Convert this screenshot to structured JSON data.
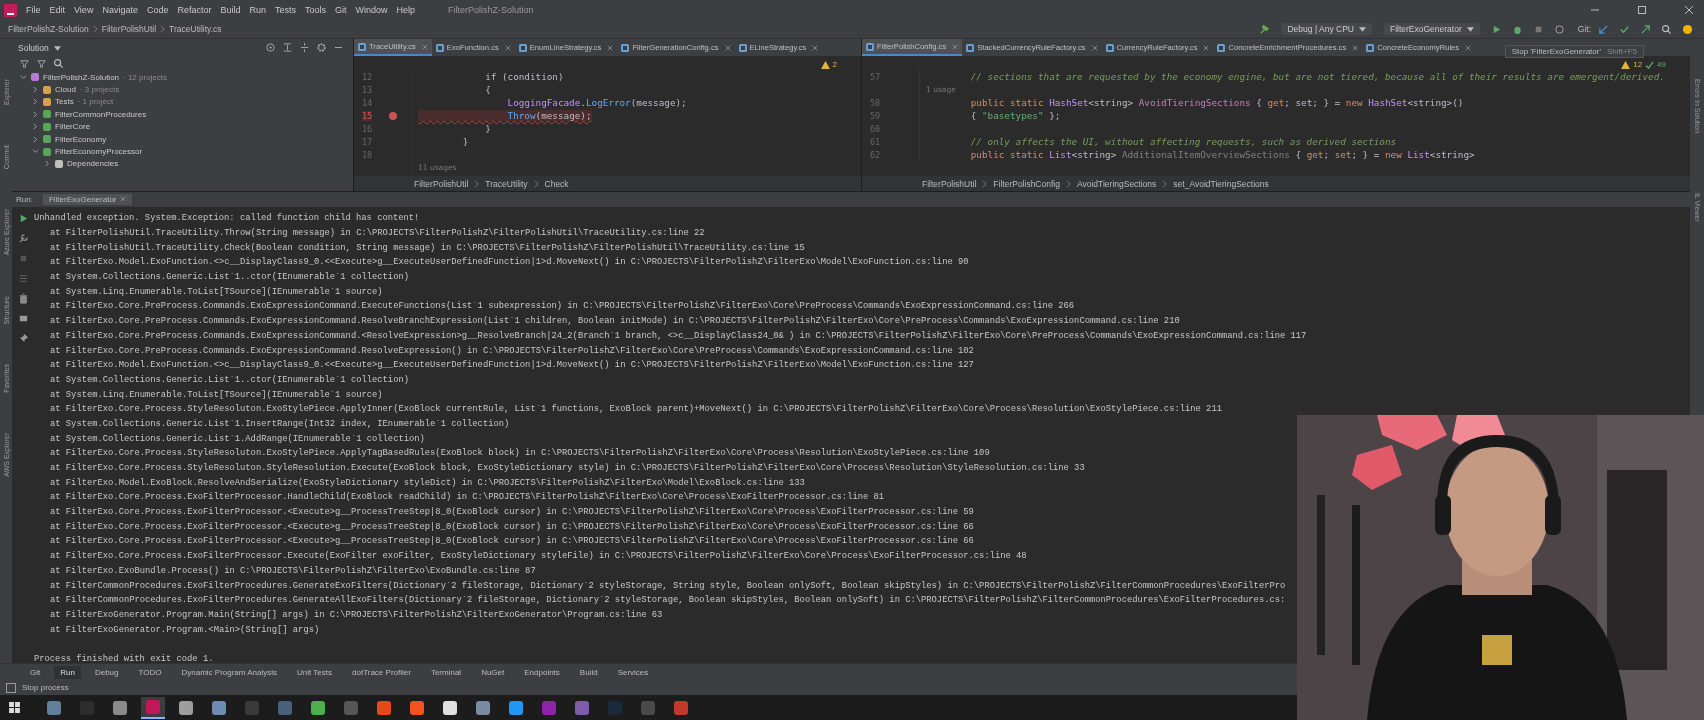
{
  "window": {
    "title": "FilterPolishZ-Solution",
    "menu": [
      "File",
      "Edit",
      "View",
      "Navigate",
      "Code",
      "Refactor",
      "Build",
      "Run",
      "Tests",
      "Tools",
      "Git",
      "Window",
      "Help"
    ]
  },
  "nav_breadcrumb": [
    "FilterPolishZ-Solution",
    "FilterPolishUtil",
    "TraceUtility.cs"
  ],
  "toolbar": {
    "configuration": "Debug | Any CPU",
    "run_target": "FilterExoGenerator",
    "git_label": "Git:",
    "tooltip": {
      "text": "Stop 'FilterExoGenerator'",
      "shortcut": "Shift+F5"
    }
  },
  "left_stripe": [
    "Explorer",
    "Commit",
    "Azure Explorer",
    "Structure",
    "Favorites",
    "AWS Explorer"
  ],
  "right_stripe": [
    "Errors In Solution",
    "IL Viewer"
  ],
  "solution_panel": {
    "title": "Solution",
    "tree": [
      {
        "label": "FilterPolishZ-Solution",
        "note": "· 12 projects",
        "kind": "solution",
        "expanded": true,
        "children": [
          {
            "label": "Cloud",
            "note": "· 3 projects",
            "kind": "folder",
            "expanded": false
          },
          {
            "label": "Tests",
            "note": "· 1 project",
            "kind": "folder",
            "expanded": false
          },
          {
            "label": "FilterCommonProcedures",
            "kind": "project",
            "expanded": false
          },
          {
            "label": "FilterCore",
            "kind": "project",
            "expanded": false
          },
          {
            "label": "FilterEconomy",
            "kind": "project",
            "expanded": false
          },
          {
            "label": "FilterEconomyProcessor",
            "kind": "project",
            "expanded": true,
            "children": [
              {
                "label": "Dependencies",
                "kind": "dependencies",
                "expanded": false
              }
            ]
          }
        ]
      }
    ]
  },
  "editors": [
    {
      "tabs": [
        {
          "label": "TraceUtility.cs",
          "selected": true
        },
        {
          "label": "ExoFunction.cs",
          "selected": false
        },
        {
          "label": "EnumLineStrategy.cs",
          "selected": false
        },
        {
          "label": "FilterGenerationConfig.cs",
          "selected": false
        },
        {
          "label": "ELineStrategy.cs",
          "selected": false
        }
      ],
      "inspections": {
        "warnings": "2"
      },
      "lines": [
        {
          "number": "12",
          "breakpoint": false,
          "error": false,
          "tokens": [
            {
              "text": "            if (condition)",
              "kind": "plain"
            }
          ]
        },
        {
          "number": "13",
          "breakpoint": false,
          "error": false,
          "tokens": [
            {
              "text": "            {",
              "kind": "plain"
            }
          ]
        },
        {
          "number": "14",
          "breakpoint": false,
          "error": false,
          "tokens": [
            {
              "text": "                LoggingFacade",
              "kind": "type"
            },
            {
              "text": ".",
              "kind": "plain"
            },
            {
              "text": "LogError",
              "kind": "method"
            },
            {
              "text": "(message);",
              "kind": "plain"
            }
          ]
        },
        {
          "number": "15",
          "breakpoint": true,
          "error": true,
          "tokens": [
            {
              "text": "                Throw",
              "kind": "method"
            },
            {
              "text": "(message);",
              "kind": "plain"
            }
          ]
        },
        {
          "number": "16",
          "breakpoint": false,
          "error": false,
          "tokens": [
            {
              "text": "            }",
              "kind": "plain"
            }
          ]
        },
        {
          "number": "17",
          "breakpoint": false,
          "error": false,
          "tokens": [
            {
              "text": "        }",
              "kind": "plain"
            }
          ]
        },
        {
          "number": "18",
          "breakpoint": false,
          "error": false
        },
        {
          "kind": "hint",
          "text": "11 usages"
        }
      ],
      "breadcrumb": [
        "FilterPolishUtil",
        "TraceUtility",
        "Check"
      ]
    },
    {
      "tabs": [
        {
          "label": "FilterPolishConfig.cs",
          "selected": true
        },
        {
          "label": "StackedCurrencyRuleFactory.cs",
          "selected": false
        },
        {
          "label": "CurrencyRuleFactory.cs",
          "selected": false
        },
        {
          "label": "ConcreteEnrichmentProcedures.cs",
          "selected": false
        },
        {
          "label": "ConcreteEconomyRules",
          "selected": false
        }
      ],
      "inspections": {
        "warnings": "12",
        "ok": "49"
      },
      "lines": [
        {
          "number": "57",
          "breakpoint": false,
          "error": false,
          "tokens": [
            {
              "text": "        // sections that are requested by the economy engine, but are not tiered, because all of their results are emergent/derived.",
              "kind": "comment"
            }
          ]
        },
        {
          "kind": "hint",
          "text": "1 usage"
        },
        {
          "number": "58",
          "breakpoint": false,
          "error": false,
          "tokens": [
            {
              "text": "        public static ",
              "kind": "keyword"
            },
            {
              "text": "HashSet",
              "kind": "type"
            },
            {
              "text": "<string> ",
              "kind": "plain"
            },
            {
              "text": "AvoidTieringSections",
              "kind": "member"
            },
            {
              "text": " { ",
              "kind": "plain"
            },
            {
              "text": "get",
              "kind": "keyword"
            },
            {
              "text": "; set; } = ",
              "kind": "plain"
            },
            {
              "text": "new ",
              "kind": "keyword"
            },
            {
              "text": "HashSet",
              "kind": "type"
            },
            {
              "text": "<string>()",
              "kind": "plain"
            }
          ]
        },
        {
          "number": "59",
          "breakpoint": false,
          "error": false,
          "tokens": [
            {
              "text": "        { ",
              "kind": "plain"
            },
            {
              "text": "\"basetypes\"",
              "kind": "string"
            },
            {
              "text": " };",
              "kind": "plain"
            }
          ]
        },
        {
          "number": "60",
          "breakpoint": false,
          "error": false
        },
        {
          "number": "61",
          "breakpoint": false,
          "error": false,
          "tokens": [
            {
              "text": "        // only affects the UI, without affecting requests, such as derived sections",
              "kind": "comment"
            }
          ]
        },
        {
          "number": "62",
          "breakpoint": false,
          "error": false,
          "tokens": [
            {
              "text": "        public static ",
              "kind": "keyword"
            },
            {
              "text": "List",
              "kind": "type"
            },
            {
              "text": "<string> ",
              "kind": "plain"
            },
            {
              "text": "AdditionalItemOverviewSections",
              "kind": "unused"
            },
            {
              "text": " { ",
              "kind": "plain"
            },
            {
              "text": "get",
              "kind": "keyword"
            },
            {
              "text": "; ",
              "kind": "plain"
            },
            {
              "text": "set",
              "kind": "keyword"
            },
            {
              "text": "; } = ",
              "kind": "plain"
            },
            {
              "text": "new ",
              "kind": "keyword"
            },
            {
              "text": "List",
              "kind": "type"
            },
            {
              "text": "<string>",
              "kind": "plain"
            }
          ]
        }
      ],
      "breadcrumb": [
        "FilterPolishUtil",
        "FilterPolishConfig",
        "AvoidTieringSections",
        "set_AvoidTieringSections"
      ]
    }
  ],
  "run_panel": {
    "label": "Run:",
    "tab": "FilterExoGenerator",
    "output": [
      {
        "kind": "error",
        "text": "Unhandled exception. System.Exception: called function child has content!"
      },
      {
        "kind": "frame",
        "text": "at FilterPolishUtil.TraceUtility.Throw(String message) in C:\\PROJECTS\\FilterPolishZ\\FilterPolishUtil\\TraceUtility.cs:line 22"
      },
      {
        "kind": "frame",
        "text": "at FilterPolishUtil.TraceUtility.Check(Boolean condition, String message) in C:\\PROJECTS\\FilterPolishZ\\FilterPolishUtil\\TraceUtility.cs:line 15"
      },
      {
        "kind": "frame",
        "text": "at FilterExo.Model.ExoFunction.<>c__DisplayClass9_0.<<Execute>g__ExecuteUserDefinedFunction|1>d.MoveNext() in C:\\PROJECTS\\FilterPolishZ\\FilterExo\\Model\\ExoFunction.cs:line 90"
      },
      {
        "kind": "frame",
        "text": "at System.Collections.Generic.List`1..ctor(IEnumerable`1 collection)"
      },
      {
        "kind": "frame",
        "text": "at System.Linq.Enumerable.ToList[TSource](IEnumerable`1 source)"
      },
      {
        "kind": "frame",
        "text": "at FilterExo.Core.PreProcess.Commands.ExoExpressionCommand.ExecuteFunctions(List`1 subexpression) in C:\\PROJECTS\\FilterPolishZ\\FilterExo\\Core\\PreProcess\\Commands\\ExoExpressionCommand.cs:line 266"
      },
      {
        "kind": "frame",
        "text": "at FilterExo.Core.PreProcess.Commands.ExoExpressionCommand.ResolveBranchExpression(List`1 children, Boolean initMode) in C:\\PROJECTS\\FilterPolishZ\\FilterExo\\Core\\PreProcess\\Commands\\ExoExpressionCommand.cs:line 210"
      },
      {
        "kind": "frame",
        "text": "at FilterExo.Core.PreProcess.Commands.ExoExpressionCommand.<ResolveExpression>g__ResolveBranch|24_2(Branch`1 branch, <>c__DisplayClass24_0& ) in C:\\PROJECTS\\FilterPolishZ\\FilterExo\\Core\\PreProcess\\Commands\\ExoExpressionCommand.cs:line 117"
      },
      {
        "kind": "frame",
        "text": "at FilterExo.Core.PreProcess.Commands.ExoExpressionCommand.ResolveExpression() in C:\\PROJECTS\\FilterPolishZ\\FilterExo\\Core\\PreProcess\\Commands\\ExoExpressionCommand.cs:line 102"
      },
      {
        "kind": "frame",
        "text": "at FilterExo.Model.ExoFunction.<>c__DisplayClass9_0.<<Execute>g__ExecuteUserDefinedFunction|1>d.MoveNext() in C:\\PROJECTS\\FilterPolishZ\\FilterExo\\Model\\ExoFunction.cs:line 127"
      },
      {
        "kind": "frame",
        "text": "at System.Collections.Generic.List`1..ctor(IEnumerable`1 collection)"
      },
      {
        "kind": "frame",
        "text": "at System.Linq.Enumerable.ToList[TSource](IEnumerable`1 source)"
      },
      {
        "kind": "frame",
        "text": "at FilterExo.Core.Process.StyleResoluton.ExoStylePiece.ApplyInner(ExoBlock currentRule, List`1 functions, ExoBlock parent)+MoveNext() in C:\\PROJECTS\\FilterPolishZ\\FilterExo\\Core\\Process\\Resolution\\ExoStylePiece.cs:line 211"
      },
      {
        "kind": "frame",
        "text": "at System.Collections.Generic.List`1.InsertRange(Int32 index, IEnumerable`1 collection)"
      },
      {
        "kind": "frame",
        "text": "at System.Collections.Generic.List`1.AddRange(IEnumerable`1 collection)"
      },
      {
        "kind": "frame",
        "text": "at FilterExo.Core.Process.StyleResoluton.ExoStylePiece.ApplyTagBasedRules(ExoBlock block) in C:\\PROJECTS\\FilterPolishZ\\FilterExo\\Core\\Process\\Resolution\\ExoStylePiece.cs:line 109"
      },
      {
        "kind": "frame",
        "text": "at FilterExo.Core.Process.StyleResoluton.StyleResolution.Execute(ExoBlock block, ExoStyleDictionary style) in C:\\PROJECTS\\FilterPolishZ\\FilterExo\\Core\\Process\\Resolution\\StyleResolution.cs:line 33"
      },
      {
        "kind": "frame",
        "text": "at FilterExo.Model.ExoBlock.ResolveAndSerialize(ExoStyleDictionary styleDict) in C:\\PROJECTS\\FilterPolishZ\\FilterExo\\Model\\ExoBlock.cs:line 133"
      },
      {
        "kind": "frame",
        "text": "at FilterExo.Core.Process.ExoFilterProcessor.HandleChild(ExoBlock readChild) in C:\\PROJECTS\\FilterPolishZ\\FilterExo\\Core\\Process\\ExoFilterProcessor.cs:line 81"
      },
      {
        "kind": "frame",
        "text": "at FilterExo.Core.Process.ExoFilterProcessor.<Execute>g__ProcessTreeStep|8_0(ExoBlock cursor) in C:\\PROJECTS\\FilterPolishZ\\FilterExo\\Core\\Process\\ExoFilterProcessor.cs:line 59"
      },
      {
        "kind": "frame",
        "text": "at FilterExo.Core.Process.ExoFilterProcessor.<Execute>g__ProcessTreeStep|8_0(ExoBlock cursor) in C:\\PROJECTS\\FilterPolishZ\\FilterExo\\Core\\Process\\ExoFilterProcessor.cs:line 66"
      },
      {
        "kind": "frame",
        "text": "at FilterExo.Core.Process.ExoFilterProcessor.<Execute>g__ProcessTreeStep|8_0(ExoBlock cursor) in C:\\PROJECTS\\FilterPolishZ\\FilterExo\\Core\\Process\\ExoFilterProcessor.cs:line 66"
      },
      {
        "kind": "frame",
        "text": "at FilterExo.Core.Process.ExoFilterProcessor.Execute(ExoFilter exoFilter, ExoStyleDictionary styleFile) in C:\\PROJECTS\\FilterPolishZ\\FilterExo\\Core\\Process\\ExoFilterProcessor.cs:line 48"
      },
      {
        "kind": "frame",
        "text": "at FilterExo.ExoBundle.Process() in C:\\PROJECTS\\FilterPolishZ\\FilterExo\\ExoBundle.cs:line 87"
      },
      {
        "kind": "frame",
        "text": "at FilterCommonProcedures.ExoFilterProcedures.GenerateExoFilters(Dictionary`2 fileStorage, Dictionary`2 styleStorage, String style, Boolean onlySoft, Boolean skipStyles) in C:\\PROJECTS\\FilterPolishZ\\FilterCommonProcedures\\ExoFilterPro"
      },
      {
        "kind": "frame",
        "text": "at FilterCommonProcedures.ExoFilterProcedures.GenerateAllExoFilters(Dictionary`2 fileStorage, Dictionary`2 styleStorage, Boolean skipStyles, Boolean onlySoft) in C:\\PROJECTS\\FilterPolishZ\\FilterCommonProcedures\\ExoFilterProcedures.cs:"
      },
      {
        "kind": "frame",
        "text": "at FilterExoGenerator.Program.Main(String[] args) in C:\\PROJECTS\\FilterPolishZ\\FilterExoGenerator\\Program.cs:line 63"
      },
      {
        "kind": "frame",
        "text": "at FilterExoGenerator.Program.<Main>(String[] args)"
      },
      {
        "kind": "blank"
      },
      {
        "kind": "exit",
        "text": "Process finished with exit code 1."
      }
    ]
  },
  "tool_tabs": [
    {
      "label": "Git",
      "selected": false
    },
    {
      "label": "Run",
      "selected": true
    },
    {
      "label": "Debug",
      "selected": false
    },
    {
      "label": "TODO",
      "selected": false
    },
    {
      "label": "Dynamic Program Analysis",
      "selected": false
    },
    {
      "label": "Unit Tests",
      "selected": false
    },
    {
      "label": "dotTrace Profiler",
      "selected": false
    },
    {
      "label": "Terminal",
      "selected": false
    },
    {
      "label": "NuGet",
      "selected": false
    },
    {
      "label": "Endpoints",
      "selected": false
    },
    {
      "label": "Build",
      "selected": false
    },
    {
      "label": "Services",
      "selected": false
    }
  ],
  "status_bar": {
    "message": "Stop process"
  },
  "taskbar": {
    "apps": [
      {
        "color": "#5f7f9a",
        "selected": false
      },
      {
        "color": "#2d2d2d",
        "selected": false
      },
      {
        "color": "#8a8a8a",
        "selected": false
      },
      {
        "color": "#c2185b",
        "selected": true
      },
      {
        "color": "#9e9e9e",
        "selected": false
      },
      {
        "color": "#6d8bb0",
        "selected": false
      },
      {
        "color": "#3a3a3a",
        "selected": false
      },
      {
        "color": "#49617d",
        "selected": false
      },
      {
        "color": "#4caf50",
        "selected": false
      },
      {
        "color": "#555555",
        "selected": false
      },
      {
        "color": "#e64a19",
        "selected": false
      },
      {
        "color": "#f4511e",
        "selected": false
      },
      {
        "color": "#e0e0e0",
        "selected": false
      },
      {
        "color": "#7a8aa0",
        "selected": false
      },
      {
        "color": "#2196f3",
        "selected": false
      },
      {
        "color": "#8e24aa",
        "selected": false
      },
      {
        "color": "#7b5ea7",
        "selected": false
      },
      {
        "color": "#1b2a3a",
        "selected": false
      },
      {
        "color": "#4a4a4a",
        "selected": false
      },
      {
        "color": "#c0392b",
        "selected": false
      }
    ]
  },
  "webcam": {
    "kind": "picture"
  }
}
